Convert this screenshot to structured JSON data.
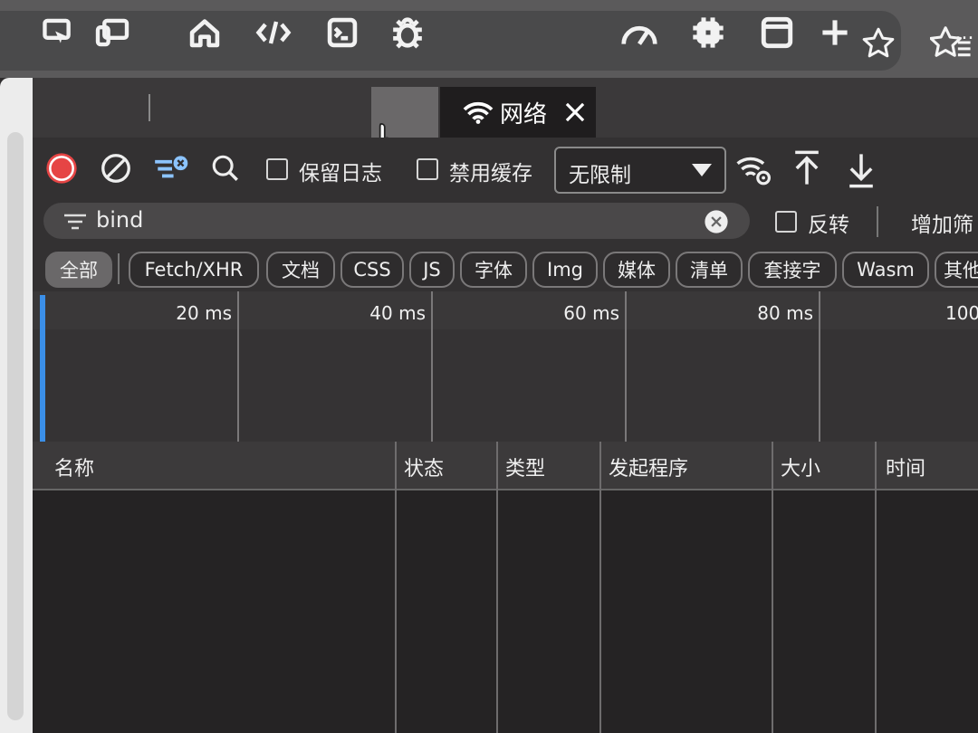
{
  "browser": {
    "icons": [
      "star-outline-icon",
      "favorites-star-icon"
    ]
  },
  "devtools_tabs": {
    "icons": [
      "inspect-icon",
      "device-emulation-icon",
      "home-icon",
      "elements-code-icon",
      "console-icon",
      "debug-bug-icon",
      "wifi-icon",
      "performance-gauge-icon",
      "memory-chip-icon",
      "application-window-icon",
      "add-tool-icon",
      "more-icon"
    ],
    "active_label": "网络",
    "more": "..."
  },
  "toolbar": {
    "preserve_log": "保留日志",
    "disable_cache": "禁用缓存",
    "throttling": "无限制"
  },
  "filter": {
    "value": "bind",
    "invert": "反转",
    "more_filters": "增加筛"
  },
  "type_filters": [
    "全部",
    "Fetch/XHR",
    "文档",
    "CSS",
    "JS",
    "字体",
    "Img",
    "媒体",
    "清单",
    "套接字",
    "Wasm",
    "其他"
  ],
  "timeline": {
    "ticks": [
      "20 ms",
      "40 ms",
      "60 ms",
      "80 ms",
      "100"
    ]
  },
  "table": {
    "columns": [
      "名称",
      "状态",
      "类型",
      "发起程序",
      "大小",
      "时间"
    ]
  }
}
